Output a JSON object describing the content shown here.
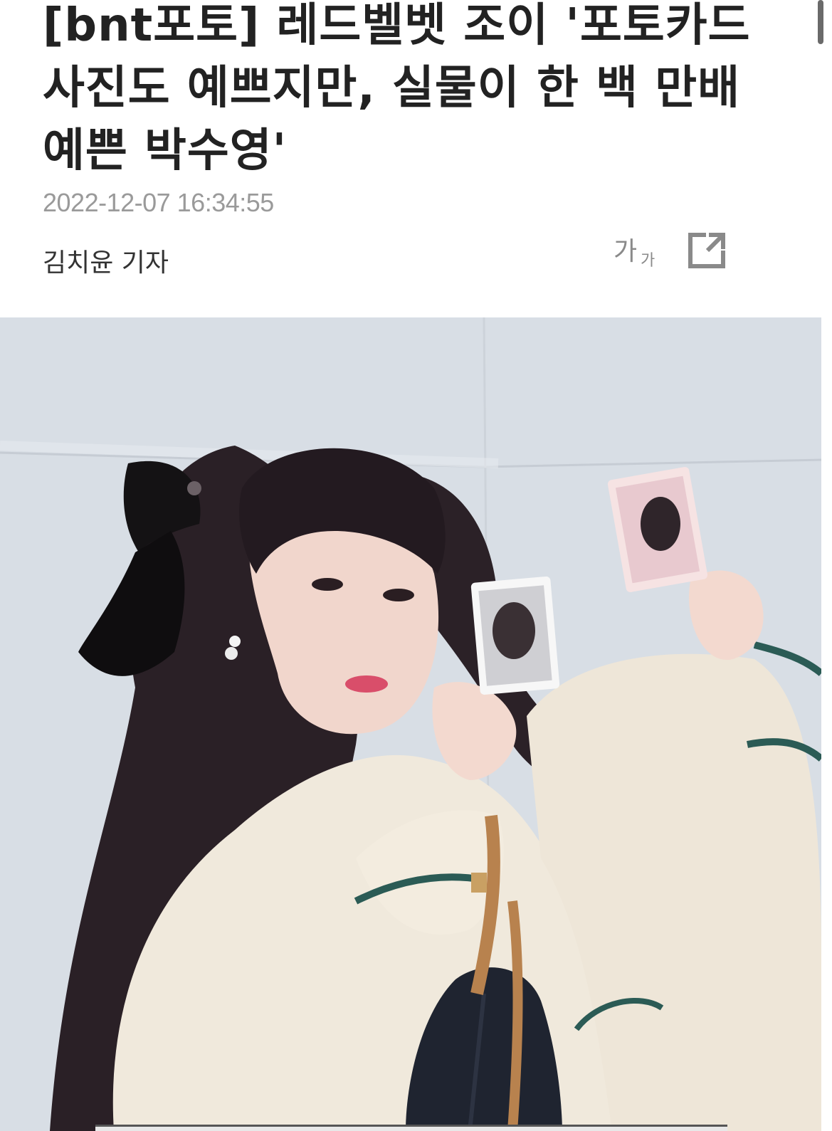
{
  "article": {
    "headline": "[bnt포토] 레드벨벳 조이 '포토카드 사진도 예쁘지만, 실물이 한 백 만배 예쁜 박수영'",
    "timestamp": "2022-12-07 16:34:55",
    "byline": "김치윤 기자"
  },
  "toolbar": {
    "font_size_big": "가",
    "font_size_small": "가",
    "font_size_icon": "font-size-icon",
    "share_icon": "share-external-icon"
  },
  "photo": {
    "subject": "photo-of-woman-holding-photocards"
  },
  "colors": {
    "headline": "#222222",
    "timestamp": "#9a9a9a",
    "icon": "#8a8a8a"
  }
}
